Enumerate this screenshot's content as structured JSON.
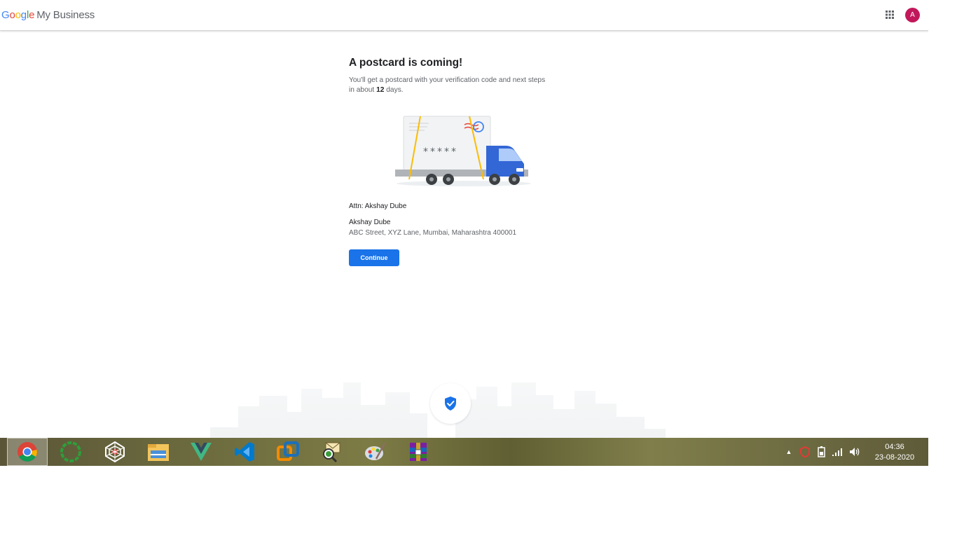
{
  "header": {
    "logo_letters": [
      "G",
      "o",
      "o",
      "g",
      "l",
      "e"
    ],
    "product": "My Business",
    "avatar_letter": "A"
  },
  "main": {
    "title": "A postcard is coming!",
    "subtitle_pre": "You'll get a postcard with your verification code and next steps in about ",
    "days": "12",
    "subtitle_post": " days.",
    "postcard_code": "*****",
    "attn": "Attn: Akshay Dube",
    "address_name": "Akshay Dube",
    "address_line": "ABC Street, XYZ Lane, Mumbai, Maharashtra 400001",
    "continue_label": "Continue"
  },
  "taskbar": {
    "apps": [
      "chrome-icon",
      "cycle-app-icon",
      "spider-app-icon",
      "file-explorer-icon",
      "vue-icon",
      "vscode-icon",
      "vmware-icon",
      "mail-search-icon",
      "paint-icon",
      "winrar-icon"
    ],
    "time": "04:36",
    "date": "23-08-2020"
  },
  "colors": {
    "primary": "#1a73e8",
    "avatar": "#c2185b",
    "google_blue": "#4285f4",
    "google_red": "#ea4335",
    "google_yellow": "#fbbc05",
    "google_green": "#34a853"
  }
}
